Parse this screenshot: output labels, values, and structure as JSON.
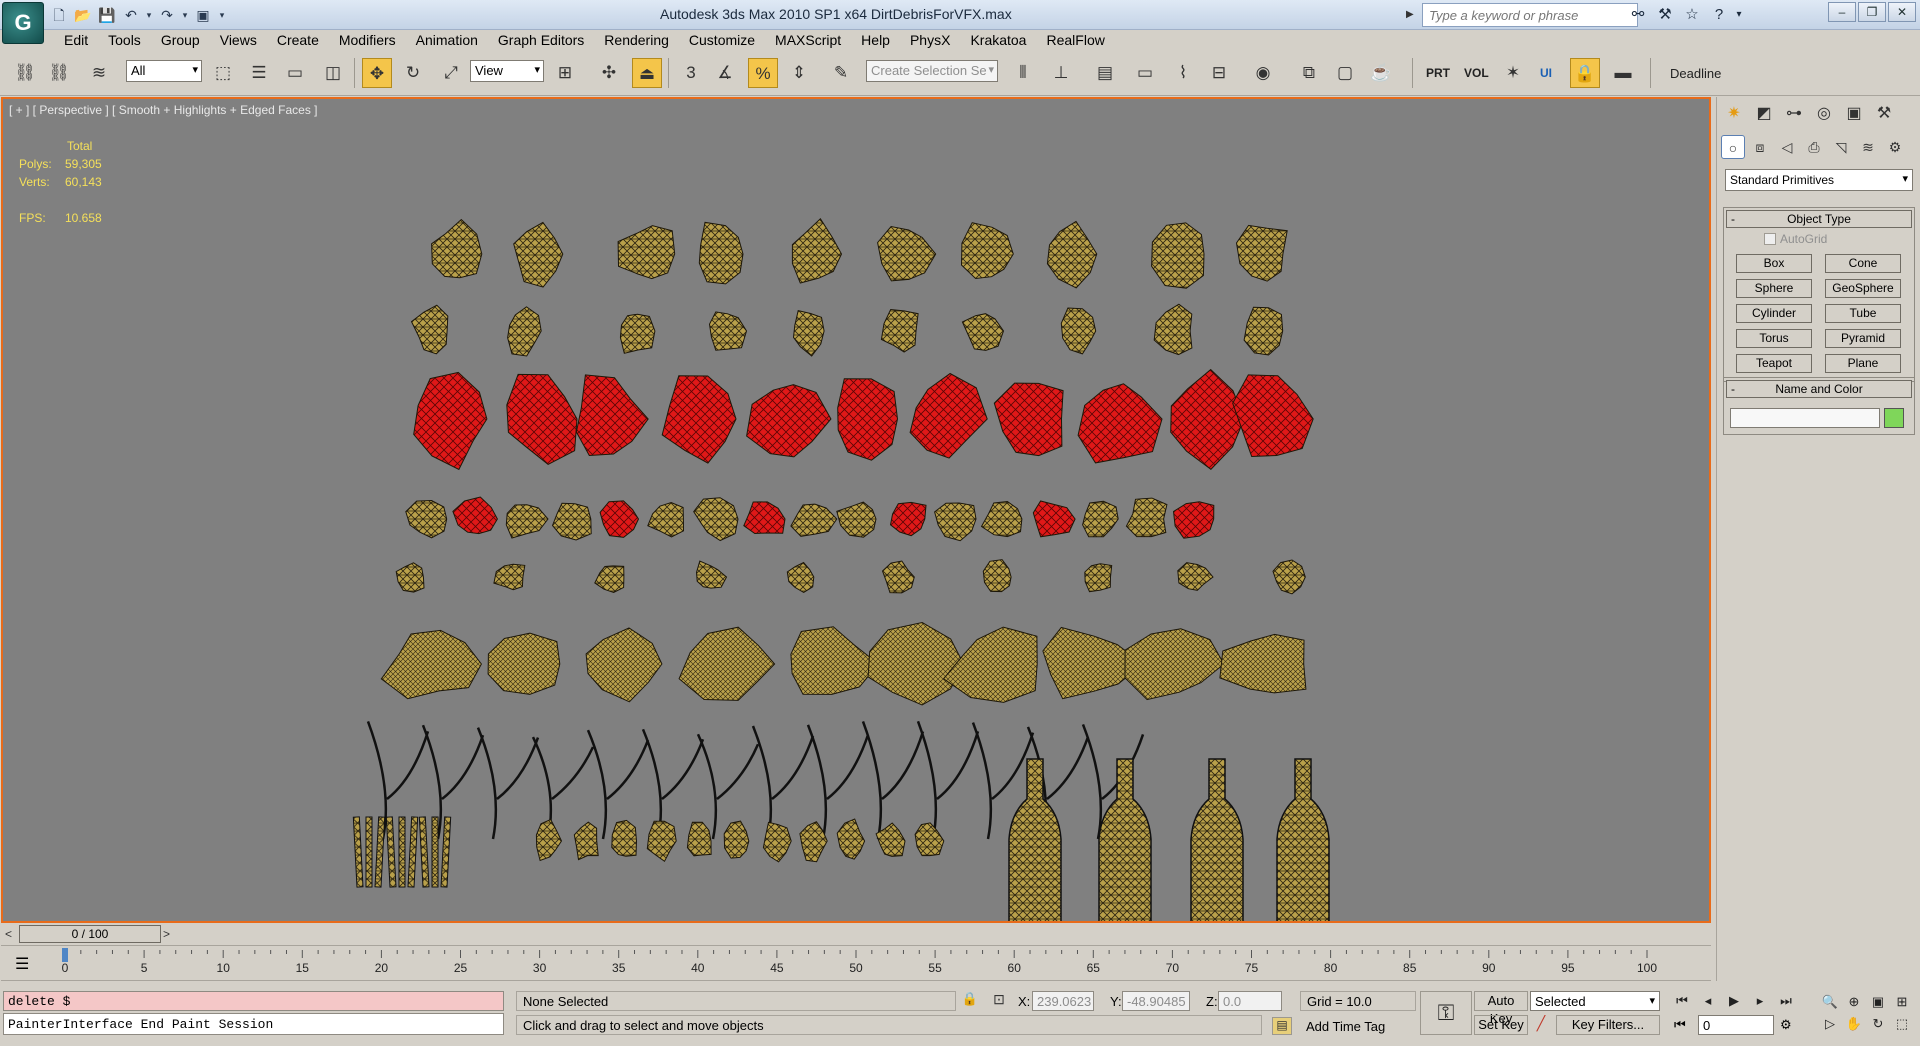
{
  "window": {
    "title": "Autodesk 3ds Max  2010 SP1 x64      DirtDebrisForVFX.max",
    "search_placeholder": "Type a keyword or phrase"
  },
  "menu": [
    "Edit",
    "Tools",
    "Group",
    "Views",
    "Create",
    "Modifiers",
    "Animation",
    "Graph Editors",
    "Rendering",
    "Customize",
    "MAXScript",
    "Help",
    "PhysX",
    "Krakatoa",
    "RealFlow"
  ],
  "toolbar": {
    "selection_filter": "All",
    "ref_coord": "View",
    "named_selection": "Create Selection Se",
    "plugin_labels": [
      "PRT",
      "VOL",
      "UI"
    ],
    "deadline_label": "Deadline"
  },
  "viewport": {
    "label": "[ + ] [ Perspective ] [ Smooth + Highlights + Edged Faces ]",
    "stats": {
      "total_label": "Total",
      "polys_label": "Polys:",
      "polys_value": "59,305",
      "verts_label": "Verts:",
      "verts_value": "60,143",
      "fps_label": "FPS:",
      "fps_value": "10.658"
    },
    "colors": {
      "background": "#808080",
      "active_border": "#e86b1a",
      "stats_text": "#f5e05a",
      "mesh_tan": "#b9a04a",
      "mesh_red": "#e01818"
    }
  },
  "timeline": {
    "frame_display": "0 / 100",
    "ticks": [
      "0",
      "5",
      "10",
      "15",
      "20",
      "25",
      "30",
      "35",
      "40",
      "45",
      "50",
      "55",
      "60",
      "65",
      "70",
      "75",
      "80",
      "85",
      "90",
      "95",
      "100"
    ]
  },
  "command_panel": {
    "category": "Standard Primitives",
    "object_type_title": "Object Type",
    "autogrid_label": "AutoGrid",
    "primitives": [
      "Box",
      "Cone",
      "Sphere",
      "GeoSphere",
      "Cylinder",
      "Tube",
      "Torus",
      "Pyramid",
      "Teapot",
      "Plane"
    ],
    "name_color_title": "Name and Color",
    "object_color": "#7fd65a"
  },
  "status": {
    "maxscript_input": "delete $",
    "maxscript_output": "PainterInterface End Paint Session",
    "selection": "None Selected",
    "prompt": "Click and drag to select and move objects",
    "x_label": "X:",
    "x_value": "239.0623",
    "y_label": "Y:",
    "y_value": "-48.90485",
    "z_label": "Z:",
    "z_value": "0.0",
    "grid": "Grid = 10.0",
    "add_time_tag": "Add Time Tag",
    "auto_key": "Auto Key",
    "set_key": "Set Key",
    "key_mode": "Selected",
    "key_filters": "Key Filters...",
    "current_frame": "0"
  }
}
